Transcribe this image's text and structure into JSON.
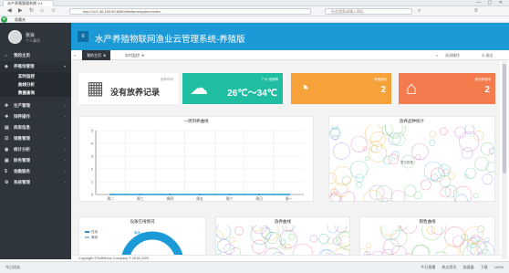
{
  "browser": {
    "tab_title": "水产养殖管理系统 V.1",
    "url": "http://101.46.165.90:8080/fishfarm/system/index",
    "search_placeholder": "在此搜索或输入网址",
    "bookmark": "收藏夹"
  },
  "sidebar": {
    "user_name": "张会",
    "user_role": "个人事项",
    "items": [
      {
        "label": "我的主页",
        "icon": "home-icon"
      },
      {
        "label": "养殖场管理",
        "icon": "fish-icon",
        "open": true,
        "children": [
          {
            "label": "实时监控"
          },
          {
            "label": "曲线分析"
          },
          {
            "label": "数据查询"
          }
        ]
      },
      {
        "label": "生产管理",
        "icon": "factory-icon"
      },
      {
        "label": "饲养操作",
        "icon": "feed-icon"
      },
      {
        "label": "库房信息",
        "icon": "warehouse-icon"
      },
      {
        "label": "销售管理",
        "icon": "sales-icon"
      },
      {
        "label": "统计分析",
        "icon": "stats-icon"
      },
      {
        "label": "财务管理",
        "icon": "finance-icon"
      },
      {
        "label": "金融服务",
        "icon": "bank-icon"
      },
      {
        "label": "系统管理",
        "icon": "settings-icon"
      }
    ]
  },
  "header": {
    "title": "水产养殖物联网渔业云管理系统-养殖版"
  },
  "tabs": {
    "active": "我的主页",
    "second": "实时监控",
    "prev": "«",
    "next": "»",
    "close_ops": "关闭操作",
    "exit": "退出"
  },
  "cards": {
    "no_record_caption": "放养时间",
    "no_record": "没有放养记录",
    "weather_label": "广州 湿润晴",
    "weather_value": "26℃～34℃",
    "area_label": "养殖面积",
    "area_value": "2",
    "pond_label": "我的养殖场",
    "pond_value": "2"
  },
  "colors": {
    "weather": "#1fbda2",
    "area": "#f6a13a",
    "pond": "#f37b4e"
  },
  "chart_data": {
    "type": "line",
    "title": "一周饵养曲线",
    "categories": [
      "周二",
      "周三",
      "周四",
      "周五",
      "周六",
      "周日",
      "周一"
    ],
    "values": [
      0,
      0,
      0,
      0,
      0,
      0,
      0
    ],
    "ylim": [
      0,
      5
    ],
    "yticks": [
      0,
      1,
      2,
      3,
      4,
      5
    ],
    "grid": true
  },
  "panels": {
    "species_title": "放养品种统计",
    "species_center": "暂无数据",
    "device_title": "设备在线情况",
    "device_legend": [
      "在线",
      "离线"
    ],
    "device_label": "离线",
    "stocking_title": "放养曲线",
    "sales_title": "销售曲线"
  },
  "footer": {
    "copyright": "Copyright ©SoftStone Company © 2016-2020"
  },
  "status": {
    "left": "今日优选",
    "items": [
      "今日直播",
      "热点资讯",
      "加速器",
      "下载",
      "100%"
    ]
  }
}
